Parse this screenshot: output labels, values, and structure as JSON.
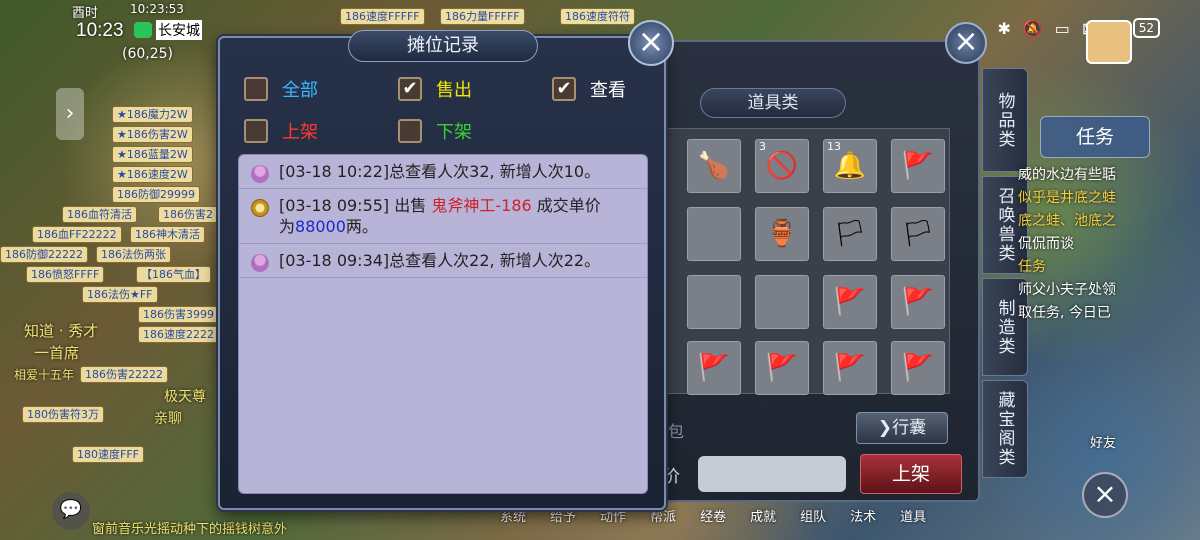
{
  "status_bar": {
    "lunar": "酉时",
    "clock_small": "10:23:53",
    "time": "10:23",
    "location": "长安城",
    "coord": "(60,25)",
    "battery": "52"
  },
  "top_tags": [
    "186速度FFFFF",
    "186力量FFFFF",
    "186速度符符"
  ],
  "left_tags": [
    "★186魔力2W",
    "★186伤害2W",
    "★186蓝量2W",
    "★186速度2W",
    "186防御29999",
    "186血符清活",
    "186伤害2",
    "186血FF22222",
    "186神木清活",
    "186防御22222",
    "186法伤两张",
    "186愤怒FFFF",
    "【186气血】",
    "186法伤★FF",
    "186伤害3999",
    "186速度2222",
    "186伤害22222",
    "180伤害符3万",
    "180速度FFF"
  ],
  "chat_lines": [
    "知道 · 秀才",
    "一首席",
    "相爱十五年",
    "极天尊",
    "亲聊"
  ],
  "bottom_text": "窗前音乐光摇动种下的摇钱树意外",
  "dialog": {
    "title": "摊位记录",
    "filters": [
      {
        "label": "全部",
        "checked": false,
        "color": "#38b8ff"
      },
      {
        "label": "售出",
        "checked": true,
        "color": "#f2e400"
      },
      {
        "label": "查看",
        "checked": true,
        "color": "#ffffff"
      },
      {
        "label": "上架",
        "checked": false,
        "color": "#ff3a2a"
      },
      {
        "label": "下架",
        "checked": false,
        "color": "#36d236"
      }
    ],
    "records": [
      {
        "type": "view",
        "text": "[03-18 10:22]总查看人次32, 新增人次10。"
      },
      {
        "type": "sell",
        "prefix": "[03-18 09:55] 出售 ",
        "item": "鬼斧神工-186",
        "mid": " 成交单价",
        "mid2": "为",
        "price": "88000",
        "suffix": "两。"
      },
      {
        "type": "view",
        "text": "[03-18 09:34]总查看人次22, 新增人次22。"
      }
    ]
  },
  "inventory": {
    "category": "道具类",
    "tabs": [
      "物品类",
      "召唤兽类",
      "制造类",
      "藏宝阁类"
    ],
    "bag_button": "行囊",
    "price_label": "单价",
    "list_button": "上架",
    "counts": [
      "3",
      "13"
    ],
    "partial_label": "包"
  },
  "right_hud": {
    "task_button": "任务",
    "task_lines": [
      "威的水边有些聒",
      "似乎是井底之蛙",
      "底之蛙、池底之",
      "侃侃而谈",
      "任务",
      "师父小夫子处领",
      "取任务, 今日已"
    ],
    "friend": "好友"
  },
  "bottom_menu": [
    "系统",
    "给予",
    "动作",
    "帮派",
    "经卷",
    "成就",
    "组队",
    "法术",
    "道具"
  ]
}
